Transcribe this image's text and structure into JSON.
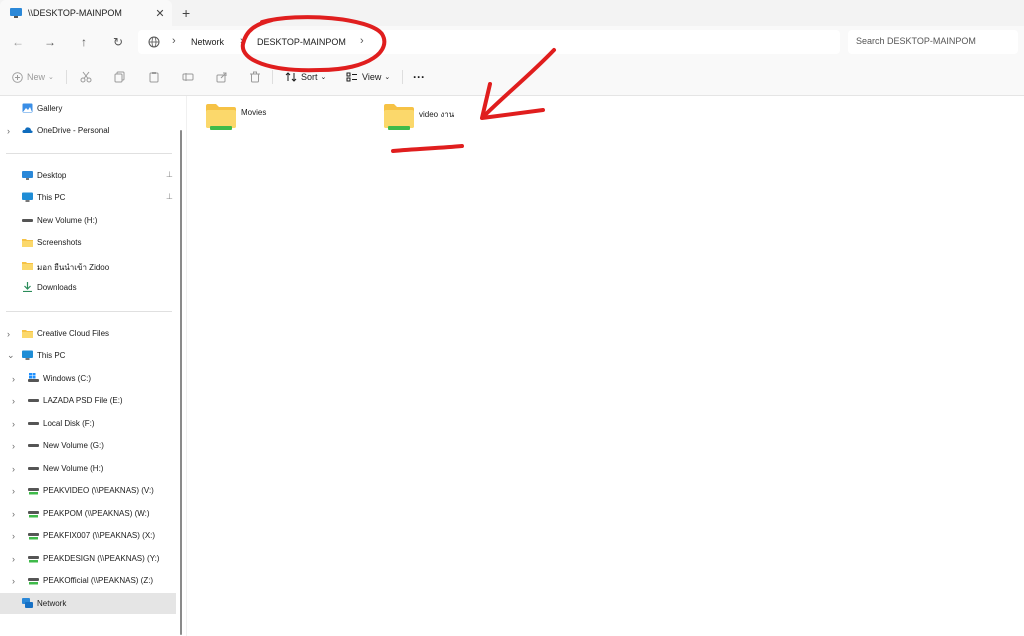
{
  "window": {
    "tab_title": "\\\\DESKTOP-MAINPOM",
    "close_glyph": "✕",
    "new_tab_glyph": "+"
  },
  "nav": {
    "back_glyph": "←",
    "forward_glyph": "→",
    "up_glyph": "↑",
    "refresh_glyph": "↻",
    "sep_glyph": "›",
    "breadcrumbs": [
      "Network",
      "DESKTOP-MAINPOM"
    ],
    "search_placeholder": "Search DESKTOP-MAINPOM"
  },
  "toolbar": {
    "new_label": "New",
    "sort_label": "Sort",
    "view_label": "View",
    "more_glyph": "···",
    "caret_glyph": "⌄"
  },
  "sidebar": {
    "items": [
      {
        "label": "Gallery",
        "icon": "gallery-icon"
      },
      {
        "label": "OneDrive - Personal",
        "icon": "cloud-icon"
      },
      {
        "label": "Desktop",
        "icon": "desktop-icon",
        "pinned": true
      },
      {
        "label": "This PC",
        "icon": "pc-icon",
        "pinned": true
      },
      {
        "label": "New Volume (H:)",
        "icon": "drive-icon"
      },
      {
        "label": "Screenshots",
        "icon": "folder-icon"
      },
      {
        "label": "มอก ยืนนำเข้า Zidoo",
        "icon": "folder-icon"
      },
      {
        "label": "Downloads",
        "icon": "download-icon"
      },
      {
        "label": "Creative Cloud Files",
        "icon": "folder-icon"
      },
      {
        "label": "This PC",
        "icon": "pc-icon"
      },
      {
        "label": "Windows (C:)",
        "icon": "windows-drive-icon"
      },
      {
        "label": "LAZADA PSD File (E:)",
        "icon": "drive-icon"
      },
      {
        "label": "Local Disk (F:)",
        "icon": "drive-icon"
      },
      {
        "label": "New Volume (G:)",
        "icon": "drive-icon"
      },
      {
        "label": "New Volume (H:)",
        "icon": "drive-icon"
      },
      {
        "label": "PEAKVIDEO (\\\\PEAKNAS) (V:)",
        "icon": "network-drive-icon"
      },
      {
        "label": "PEAKPOM (\\\\PEAKNAS) (W:)",
        "icon": "network-drive-icon"
      },
      {
        "label": "PEAKFIX007 (\\\\PEAKNAS) (X:)",
        "icon": "network-drive-icon"
      },
      {
        "label": "PEAKDESIGN (\\\\PEAKNAS) (Y:)",
        "icon": "network-drive-icon"
      },
      {
        "label": "PEAKOfficial (\\\\PEAKNAS) (Z:)",
        "icon": "network-drive-icon"
      },
      {
        "label": "Network",
        "icon": "network-icon",
        "selected": true
      }
    ],
    "chevron_right": "›",
    "chevron_down": "⌄",
    "pin_glyph": "📌"
  },
  "content": {
    "folders": [
      {
        "name": "Movies"
      },
      {
        "name": "video งาน"
      }
    ]
  },
  "colors": {
    "accent": "#0067c0",
    "folder_yellow": "#f8c94a",
    "annotation_red": "#e01e1e",
    "selected_bg": "#e5e5e5"
  }
}
